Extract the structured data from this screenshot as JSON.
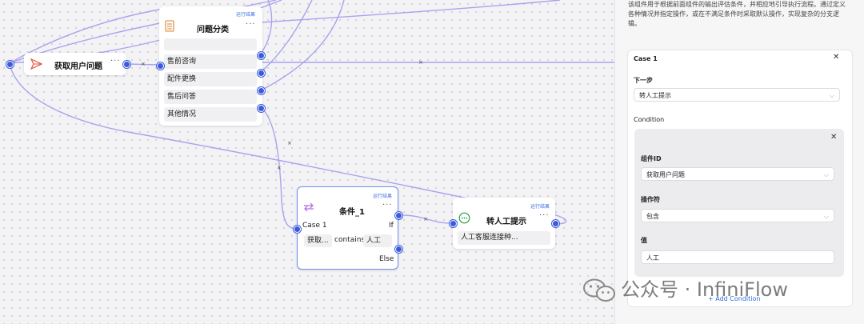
{
  "nodes": {
    "get_question": {
      "title": "获取用户问题"
    },
    "classify": {
      "title": "问题分类",
      "run_label": "运行结果",
      "categories": [
        "售前咨询",
        "配件更换",
        "售后问答",
        "其他情况"
      ]
    },
    "condition": {
      "title": "条件_1",
      "run_label": "运行结果",
      "case_label": "Case 1",
      "if_label": "If",
      "else_label": "Else",
      "expr_component": "获取...",
      "expr_operator": "contains",
      "expr_value": "人工"
    },
    "transfer": {
      "title": "转人工提示",
      "run_label": "运行结果",
      "message": "人工客服连接种..."
    }
  },
  "edge_delete_glyph": "×",
  "menu_glyph": "···",
  "panel": {
    "description": "该组件用于根据前面组件的输出评估条件，并相应地引导执行流程。通过定义各种情况并指定操作，或在不满足条件时采取默认操作，实现复杂的分支逻辑。",
    "case_title": "Case 1",
    "next_step_label": "下一步",
    "next_step_value": "转人工提示",
    "condition_label": "Condition",
    "component_id_label": "组件ID",
    "component_id_value": "获取用户问题",
    "operator_label": "操作符",
    "operator_value": "包含",
    "value_label": "值",
    "value_value": "人工",
    "add_condition": "+ Add Condition"
  },
  "watermark": "公众号 · InfiniFlow",
  "colors": {
    "accent": "#3b5bdb",
    "edge": "#a9a3ee",
    "link": "#2f6ce0"
  },
  "icons": [
    "send-icon",
    "list-icon",
    "switch-icon",
    "message-icon",
    "close-icon",
    "chevron-down-icon",
    "wechat-icon"
  ]
}
